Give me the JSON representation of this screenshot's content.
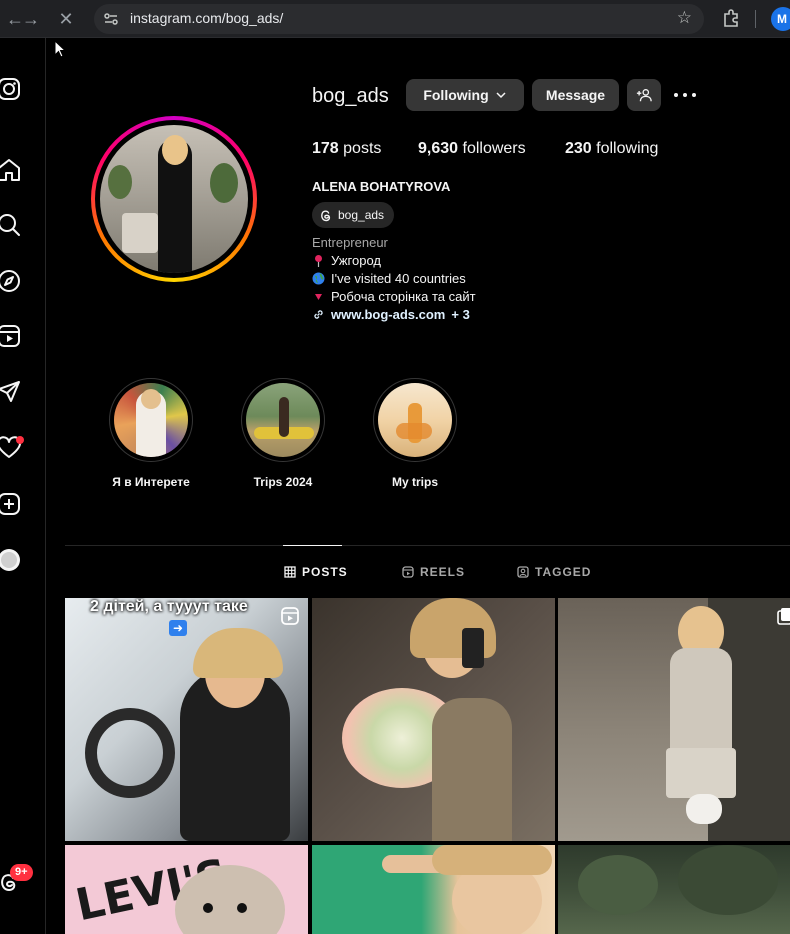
{
  "browser": {
    "url": "instagram.com/bog_ads/",
    "profile_initial": "M"
  },
  "sidebar": {
    "notification_badge": "9+"
  },
  "profile": {
    "username": "bog_ads",
    "following_label": "Following",
    "message_label": "Message",
    "stats": {
      "posts_count": "178",
      "posts_label": "posts",
      "followers_count": "9,630",
      "followers_label": "followers",
      "following_count": "230",
      "following_label": "following"
    },
    "full_name": "ALENA BOHATYROVA",
    "threads_handle": "bog_ads",
    "category": "Entrepreneur",
    "bio": {
      "line1": "Ужгород",
      "line2": "I've visited 40 countries",
      "line3": "Робоча сторінка та сайт"
    },
    "link": "www.bog-ads.com",
    "link_more": "+ 3"
  },
  "highlights": [
    {
      "label": "Я в Интерете"
    },
    {
      "label": "Trips 2024"
    },
    {
      "label": "My trips"
    }
  ],
  "tabs": {
    "posts": "POSTS",
    "reels": "REELS",
    "tagged": "TAGGED"
  },
  "posts": {
    "first_caption": "2 дітей, а тууут таке"
  },
  "colors": {
    "background": "#000000",
    "button": "#363636",
    "notification": "#ff3040",
    "link": "#e0f1ff"
  }
}
